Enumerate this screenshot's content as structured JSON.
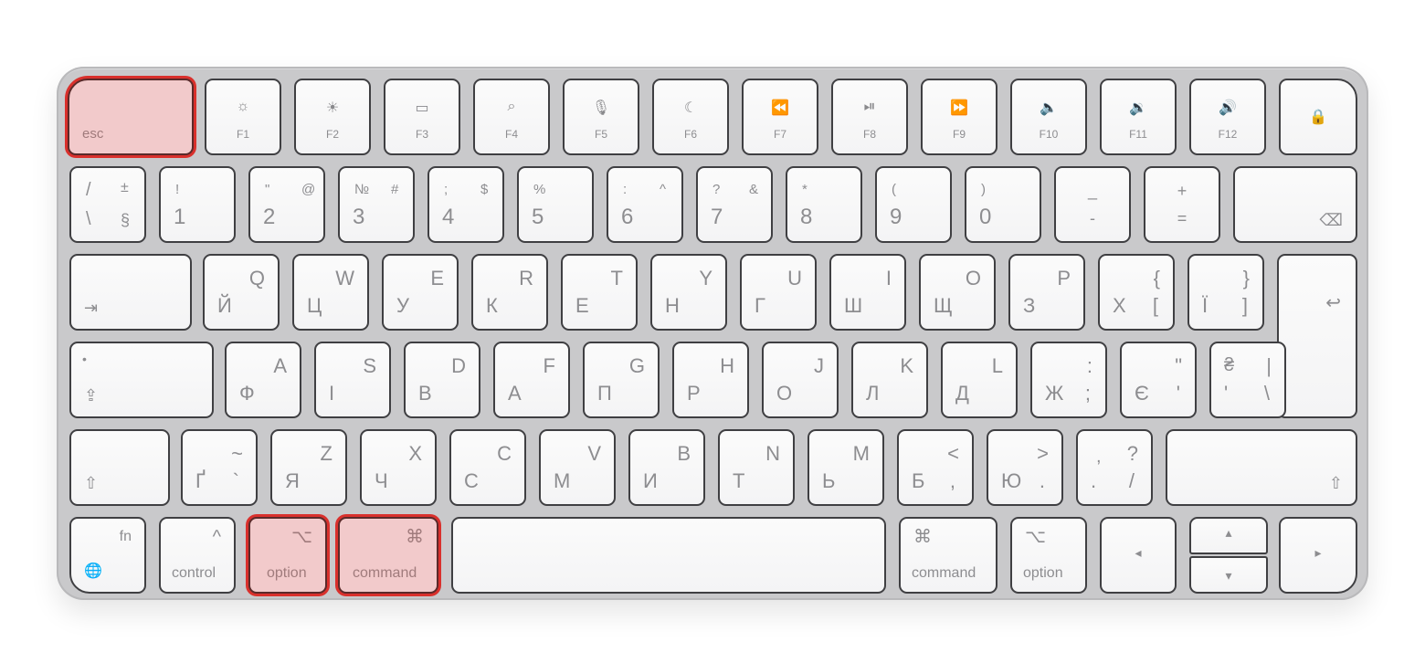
{
  "keyboard": {
    "name": "Apple Magic Keyboard (Ukrainian layout)",
    "highlight_color": "#d9302c",
    "highlight_fill": "#f2cacb",
    "highlighted_keys": [
      "esc",
      "option-left",
      "command-left"
    ],
    "row_fn": {
      "esc": "esc",
      "f_keys": [
        {
          "label": "F1",
          "icon": "brightness-down-icon",
          "glyph": "☼"
        },
        {
          "label": "F2",
          "icon": "brightness-up-icon",
          "glyph": "☀"
        },
        {
          "label": "F3",
          "icon": "mission-control-icon",
          "glyph": "▭"
        },
        {
          "label": "F4",
          "icon": "search-icon",
          "glyph": "⌕"
        },
        {
          "label": "F5",
          "icon": "microphone-icon",
          "glyph": "🎙"
        },
        {
          "label": "F6",
          "icon": "moon-icon",
          "glyph": "☾"
        },
        {
          "label": "F7",
          "icon": "rewind-icon",
          "glyph": "⏪"
        },
        {
          "label": "F8",
          "icon": "play-pause-icon",
          "glyph": "⏯"
        },
        {
          "label": "F9",
          "icon": "fast-forward-icon",
          "glyph": "⏩"
        },
        {
          "label": "F10",
          "icon": "mute-icon",
          "glyph": "🔈"
        },
        {
          "label": "F11",
          "icon": "volume-down-icon",
          "glyph": "🔉"
        },
        {
          "label": "F12",
          "icon": "volume-up-icon",
          "glyph": "🔊"
        }
      ],
      "lock_glyph": "🔒"
    },
    "row_num": {
      "keys": [
        {
          "tl": "/",
          "tr": "±",
          "bl": "\\",
          "br": "§"
        },
        {
          "tl": "!",
          "tr": "",
          "bl": "1",
          "br": ""
        },
        {
          "tl": "\"",
          "tr": "@",
          "bl": "2",
          "br": ""
        },
        {
          "tl": "№",
          "tr": "#",
          "bl": "3",
          "br": ""
        },
        {
          "tl": ";",
          "tr": "$",
          "bl": "4",
          "br": ""
        },
        {
          "tl": "%",
          "tr": "",
          "bl": "5",
          "br": ""
        },
        {
          "tl": ":",
          "tr": "^",
          "bl": "6",
          "br": ""
        },
        {
          "tl": "?",
          "tr": "&",
          "bl": "7",
          "br": ""
        },
        {
          "tl": "*",
          "tr": "",
          "bl": "8",
          "br": ""
        },
        {
          "tl": "(",
          "tr": "",
          "bl": "9",
          "br": ""
        },
        {
          "tl": ")",
          "tr": "",
          "bl": "0",
          "br": ""
        },
        {
          "tl": "_",
          "tr": "",
          "bl": "-",
          "br": ""
        },
        {
          "tl": "+",
          "tr": "",
          "bl": "=",
          "br": ""
        }
      ],
      "delete_glyph": "⌫"
    },
    "row_q": {
      "tab_glyph": "⇥",
      "keys": [
        {
          "en": "Q",
          "ua": "Й"
        },
        {
          "en": "W",
          "ua": "Ц"
        },
        {
          "en": "E",
          "ua": "У"
        },
        {
          "en": "R",
          "ua": "К"
        },
        {
          "en": "T",
          "ua": "Е"
        },
        {
          "en": "Y",
          "ua": "Н"
        },
        {
          "en": "U",
          "ua": "Г"
        },
        {
          "en": "I",
          "ua": "Ш"
        },
        {
          "en": "O",
          "ua": "Щ"
        },
        {
          "en": "P",
          "ua": "З"
        },
        {
          "en": "{",
          "ua": "Х",
          "extra": "["
        },
        {
          "en": "}",
          "ua": "Ї",
          "extra": "]"
        }
      ],
      "return_glyph": "↩"
    },
    "row_a": {
      "caps_dot": "•",
      "caps_glyph": "⇪",
      "keys": [
        {
          "en": "A",
          "ua": "Ф"
        },
        {
          "en": "S",
          "ua": "І"
        },
        {
          "en": "D",
          "ua": "В"
        },
        {
          "en": "F",
          "ua": "А"
        },
        {
          "en": "G",
          "ua": "П"
        },
        {
          "en": "H",
          "ua": "Р"
        },
        {
          "en": "J",
          "ua": "О"
        },
        {
          "en": "K",
          "ua": "Л"
        },
        {
          "en": "L",
          "ua": "Д"
        },
        {
          "en": ":",
          "ua": "Ж",
          "extra": ";"
        },
        {
          "en": "\"",
          "ua": "Є",
          "extra": "'"
        },
        {
          "en": "|",
          "ua": "'",
          "extra": "\\",
          "top_left": "₴"
        }
      ]
    },
    "row_z": {
      "shift_glyph": "⇧",
      "keys": [
        {
          "en": "~",
          "ua": "Ґ",
          "extra": "`"
        },
        {
          "en": "Z",
          "ua": "Я"
        },
        {
          "en": "X",
          "ua": "Ч"
        },
        {
          "en": "C",
          "ua": "С"
        },
        {
          "en": "V",
          "ua": "М"
        },
        {
          "en": "B",
          "ua": "И"
        },
        {
          "en": "N",
          "ua": "Т"
        },
        {
          "en": "M",
          "ua": "Ь"
        },
        {
          "en": "<",
          "ua": "Б",
          "extra": ","
        },
        {
          "en": ">",
          "ua": "Ю",
          "extra": "."
        },
        {
          "en": "?",
          "ua": ".",
          "extra": "/",
          "top_left": ","
        }
      ]
    },
    "row_bottom": {
      "fn": "fn",
      "globe_glyph": "🌐",
      "control": "control",
      "control_glyph": "^",
      "option": "option",
      "option_glyph": "⌥",
      "command": "command",
      "command_glyph": "⌘",
      "arrow_left": "◂",
      "arrow_up": "▴",
      "arrow_down": "▾",
      "arrow_right": "▸"
    }
  }
}
